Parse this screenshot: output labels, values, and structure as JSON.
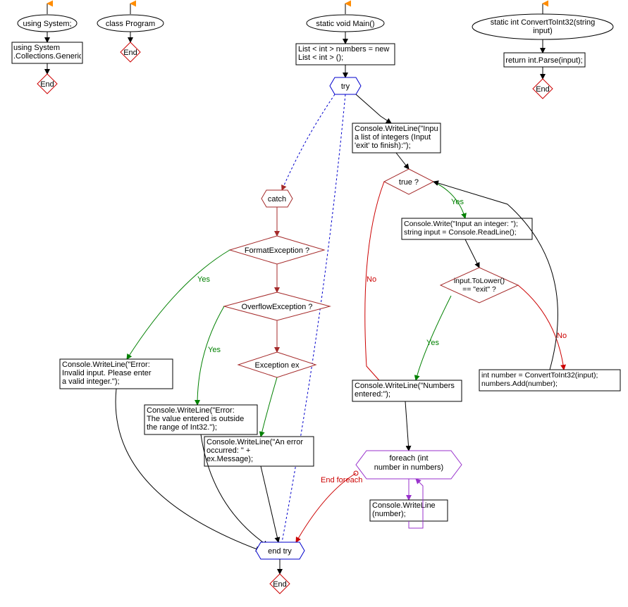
{
  "nodes": {
    "usingSystemEllipse": "using System;",
    "usingSystemCollections": "using System\n.Collections.Generic;",
    "classProgramEllipse": "class Program",
    "mainEllipse": "static void Main()",
    "listDecl": "List < int > numbers = new\nList < int > ();",
    "tryNode": "try",
    "catchNode": "catch",
    "formatExc": "FormatException ?",
    "overflowExc": "OverflowException ?",
    "exceptionEx": "Exception ex",
    "errInvalid": "Console.WriteLine(\"Error:\nInvalid input. Please enter\na valid integer.\");",
    "errRange": "Console.WriteLine(\"Error:\nThe value entered is outside\nthe range of Int32.\");",
    "errOccurred": "Console.WriteLine(\"An error\noccurred: \" + \nex.Message);",
    "endTry": "end try",
    "endLabel": "End",
    "inputListPrompt": "Console.WriteLine(\"Input\na list of integers (Input\n'exit' to finish):\");",
    "trueDiamond": "true ?",
    "inputInteger": "Console.Write(\"Input an integer: \");\nstring input = Console.ReadLine();",
    "exitCheck": "input.ToLower()\n== \"exit\" ?",
    "numbersEntered": "Console.WriteLine(\"Numbers\nentered:\");",
    "convertAndAdd": "int number = ConvertToInt32(input);\nnumbers.Add(number);",
    "foreachLoop": "foreach  (int\nnumber in numbers)",
    "writeNumber": "Console.WriteLine\n(number);",
    "convertEllipse": "static int ConvertToInt32(string\ninput)",
    "returnParse": "return int.Parse(input);",
    "yesLabel": "Yes",
    "noLabel": "No",
    "endForeach": "End foreach"
  }
}
